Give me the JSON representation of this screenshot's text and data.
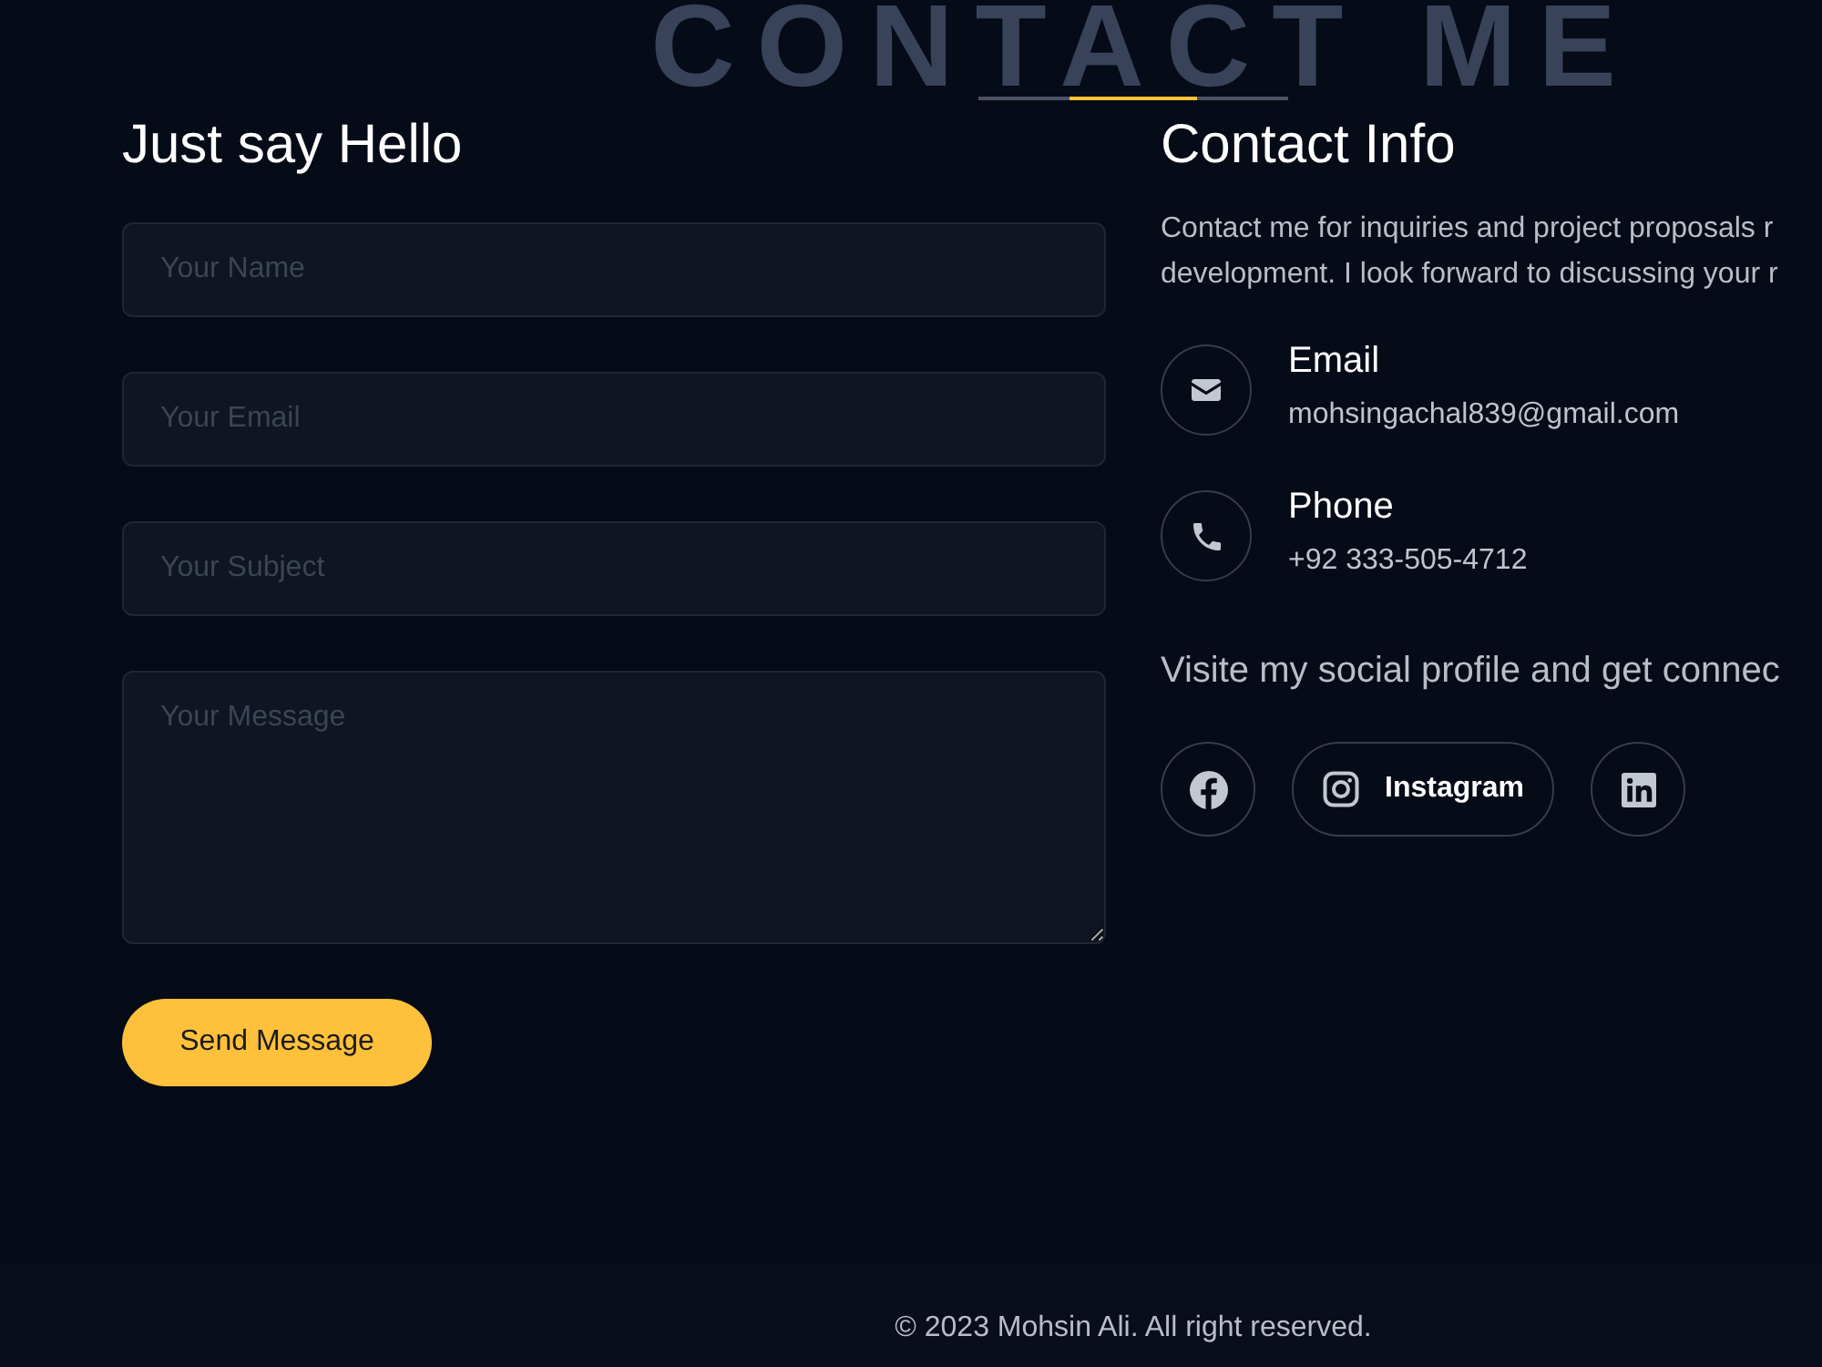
{
  "section_backdrop_title": "CONTACT ME",
  "form": {
    "title": "Just say Hello",
    "fields": [
      {
        "kind": "input",
        "placeholder": "Your Name"
      },
      {
        "kind": "input",
        "placeholder": "Your Email"
      },
      {
        "kind": "input",
        "placeholder": "Your Subject"
      },
      {
        "kind": "textarea",
        "placeholder": "Your Message"
      }
    ],
    "submit_button": "Send Message"
  },
  "contact_info": {
    "title": "Contact Info",
    "description": "Contact me for inquiries and project proposals r\ndevelopment. I look forward to discussing your r",
    "items": [
      {
        "kind": "email",
        "label": "Email",
        "value": "mohsingachal839@gmail.com"
      },
      {
        "kind": "phone",
        "label": "Phone",
        "value": "+92 333-505-4712"
      }
    ],
    "social_heading": "Visite my social profile and get connec",
    "social_links": [
      {
        "kind": "facebook"
      },
      {
        "kind": "instagram",
        "label": "Instagram"
      },
      {
        "kind": "linkedin"
      }
    ]
  },
  "footer": {
    "copyright": "© 2023 Mohsin Ali. All right reserved."
  }
}
